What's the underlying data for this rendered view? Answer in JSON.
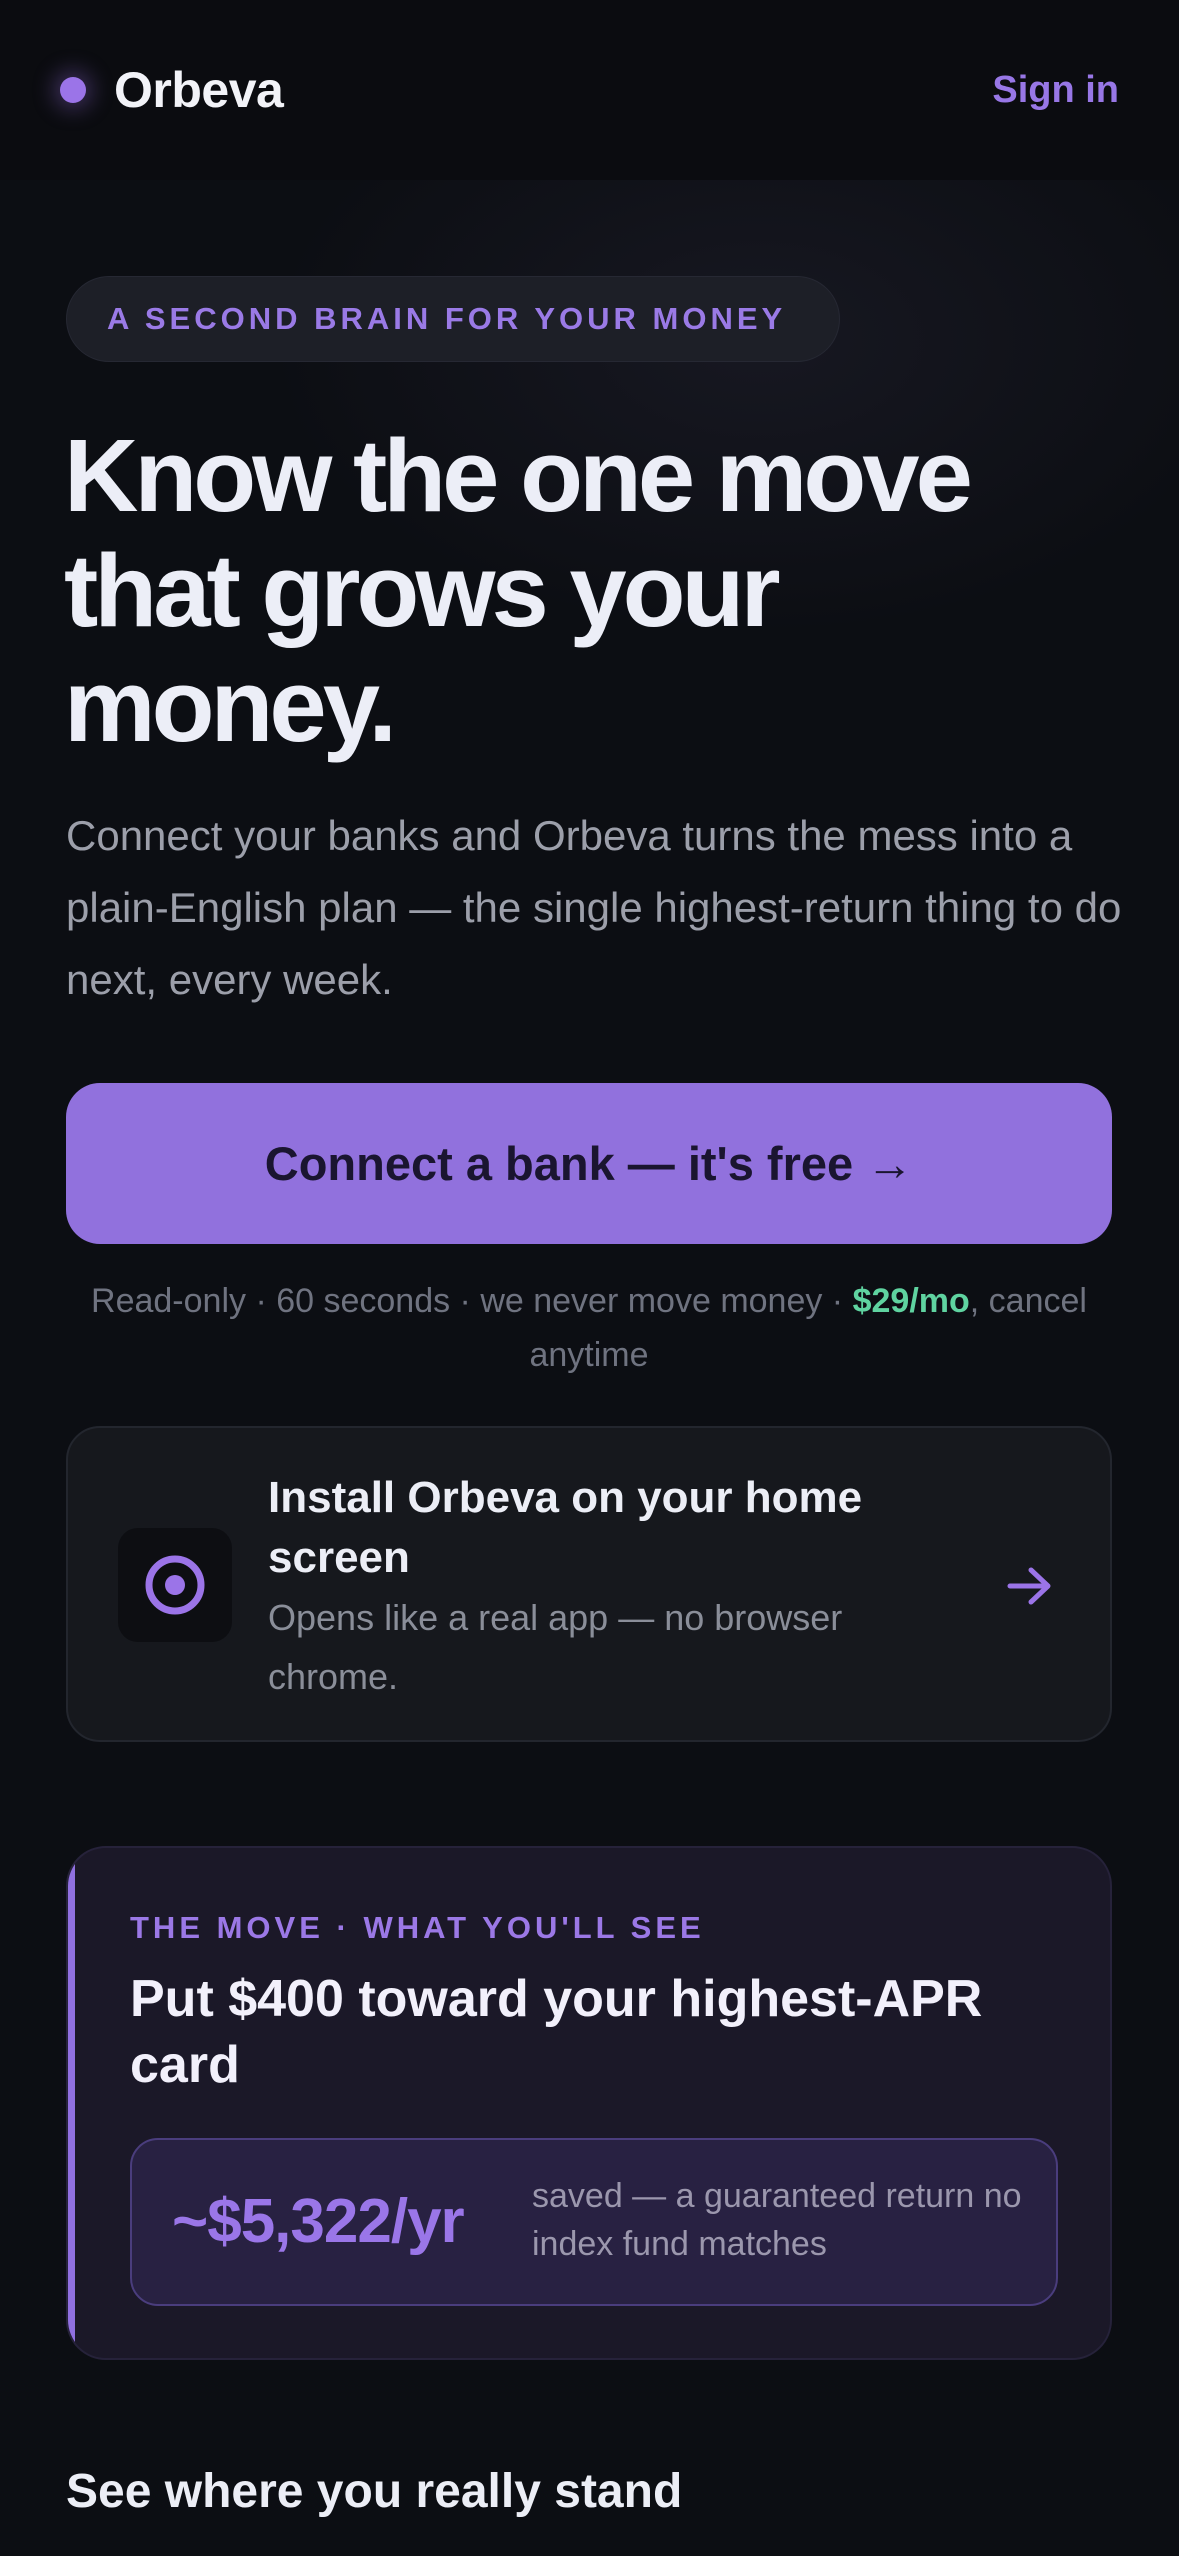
{
  "header": {
    "brand": "Orbeva",
    "sign_in": "Sign in"
  },
  "hero": {
    "eyebrow": "A SECOND BRAIN FOR YOUR MONEY",
    "headline_line1": "Know the one move",
    "headline_line2": "that grows your",
    "headline_line3": "money.",
    "subcopy": "Connect your banks and Orbeva turns the mess into a plain-English plan — the single highest-return thing to do next, every week.",
    "cta": "Connect a bank — it's free →",
    "fineprint_prefix": "Read-only · 60 seconds · we never move money · ",
    "fineprint_price": "$29/mo",
    "fineprint_suffix": ", cancel anytime"
  },
  "install": {
    "title": "Install Orbeva on your home screen",
    "subtitle": "Opens like a real app — no browser chrome.",
    "icon": "target-icon",
    "arrow_icon": "arrow-right-icon"
  },
  "move": {
    "eyebrow": "THE MOVE · WHAT YOU'LL SEE",
    "title": "Put $400 toward your highest-APR card",
    "stat_value": "~$5,322/yr",
    "stat_desc": "saved — a guaranteed return no index fund matches"
  },
  "next_section": {
    "title": "See where you really stand"
  },
  "colors": {
    "accent": "#9171dd",
    "price": "#5fd3a0",
    "background": "#0c0e13"
  }
}
